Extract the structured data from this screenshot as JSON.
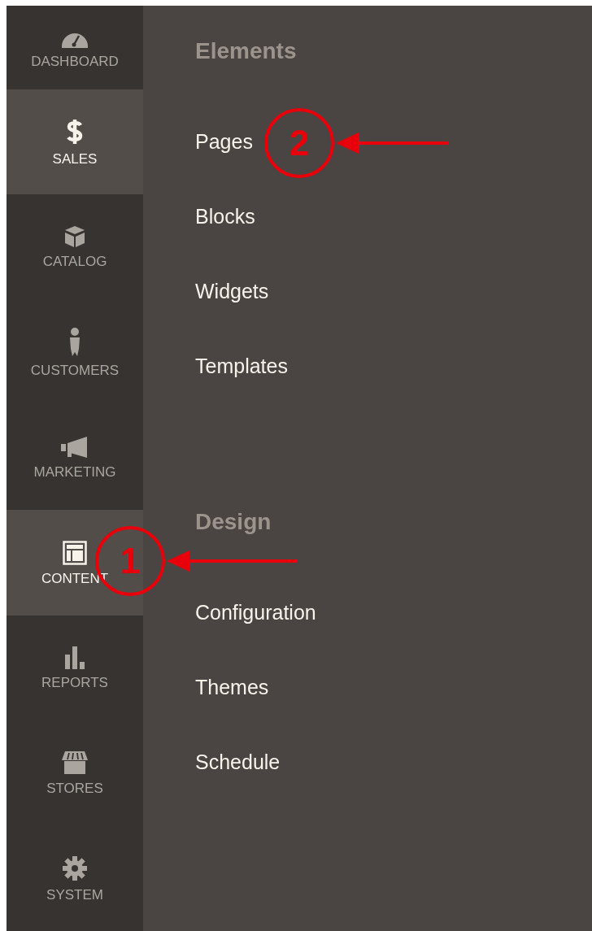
{
  "sidebar": {
    "items": [
      {
        "label": "DASHBOARD",
        "selected": false
      },
      {
        "label": "SALES",
        "selected": true
      },
      {
        "label": "CATALOG",
        "selected": false
      },
      {
        "label": "CUSTOMERS",
        "selected": false
      },
      {
        "label": "MARKETING",
        "selected": false
      },
      {
        "label": "CONTENT",
        "selected": true
      },
      {
        "label": "REPORTS",
        "selected": false
      },
      {
        "label": "STORES",
        "selected": false
      },
      {
        "label": "SYSTEM",
        "selected": false
      }
    ]
  },
  "submenu": {
    "sections": [
      {
        "title": "Elements",
        "items": [
          "Pages",
          "Blocks",
          "Widgets",
          "Templates"
        ]
      },
      {
        "title": "Design",
        "items": [
          "Configuration",
          "Themes",
          "Schedule"
        ]
      }
    ]
  },
  "callouts": [
    {
      "number": "2"
    },
    {
      "number": "1"
    }
  ]
}
